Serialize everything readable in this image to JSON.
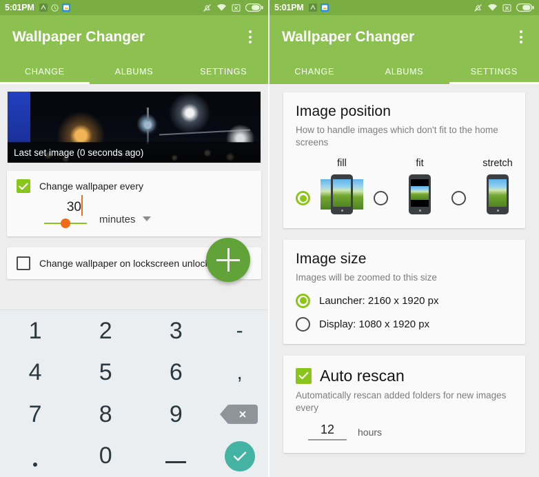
{
  "colors": {
    "app_bar_green": "#8cc152",
    "status_bar_green": "#7aae43",
    "accent_green": "#8ac51b",
    "fab_green": "#61a338",
    "slider_orange": "#ef6c1a",
    "keypad_bg": "#eaeef1",
    "confirm_teal": "#45b3a3",
    "page_bg": "#ededed",
    "card_bg": "#fafafa"
  },
  "status_bar": {
    "time": "5:01PM",
    "left_icons": [
      "app-badge-icon",
      "clock-icon",
      "gallery-icon"
    ],
    "right_icons": [
      "mute-bell-icon",
      "wifi-icon",
      "sim-x-icon",
      "battery-icon"
    ]
  },
  "app": {
    "title": "Wallpaper Changer",
    "overflow_menu": "more-options"
  },
  "tabs": [
    {
      "label": "CHANGE"
    },
    {
      "label": "ALBUMS"
    },
    {
      "label": "SETTINGS"
    }
  ],
  "left_screen": {
    "active_tab": "CHANGE",
    "preview": {
      "caption": "Last set image (0 seconds ago)"
    },
    "interval_option": {
      "label": "Change wallpaper every",
      "checked": true,
      "value": "30",
      "unit": "minutes"
    },
    "lockscreen_option": {
      "label": "Change wallpaper on lockscreen unlock",
      "checked": false
    },
    "fab": {
      "label": "add-album"
    },
    "keypad": {
      "keys": [
        "1",
        "2",
        "3",
        "-",
        "4",
        "5",
        "6",
        ",",
        "7",
        "8",
        "9",
        "backspace",
        ".",
        "0",
        "space",
        "confirm"
      ]
    }
  },
  "right_screen": {
    "active_tab": "SETTINGS",
    "image_position": {
      "title": "Image position",
      "subtitle": "How to handle images which don't fit to the home screens",
      "options": [
        {
          "label": "fill",
          "selected": true
        },
        {
          "label": "fit",
          "selected": false
        },
        {
          "label": "stretch",
          "selected": false
        }
      ]
    },
    "image_size": {
      "title": "Image size",
      "subtitle": "Images will be zoomed to this size",
      "options": [
        {
          "label": "Launcher: 2160 x 1920 px",
          "selected": true
        },
        {
          "label": "Display: 1080 x 1920 px",
          "selected": false
        }
      ]
    },
    "auto_rescan": {
      "title": "Auto rescan",
      "checked": true,
      "subtitle": "Automatically rescan added folders for new images every",
      "value": "12",
      "unit": "hours"
    }
  }
}
